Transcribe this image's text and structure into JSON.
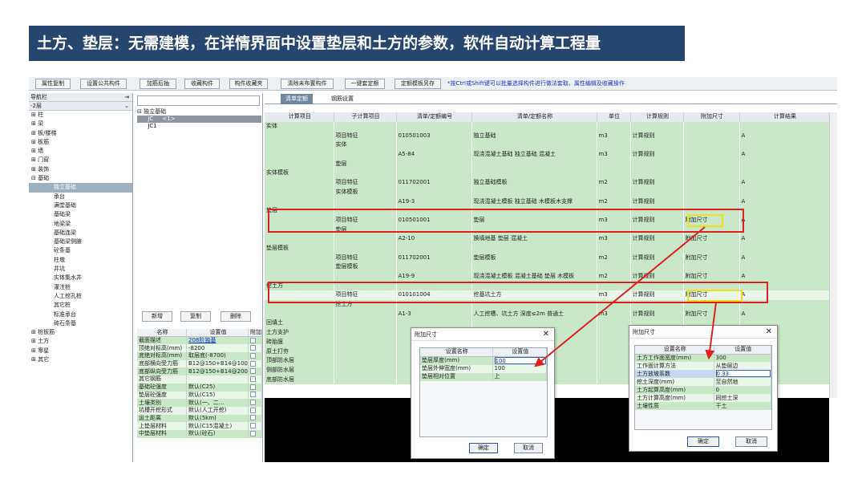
{
  "banner": {
    "title": "土方、垫层：无需建模，在详情界面中设置垫层和土方的参数，软件自动计算工程量"
  },
  "toolbar": {
    "buttons": [
      "属性复制",
      "设置公共构件",
      "加筋后抽",
      "收藏构件",
      "构件收藏夹",
      "清除未布置构件",
      "一键套定额",
      "定额模板另存"
    ],
    "note": "*按Ctrl或Shift键可以批量选择构件进行做法套取、属性编辑及收藏操作"
  },
  "nav": {
    "title": "导航栏",
    "floor": "-2层",
    "items": [
      {
        "label": "⊞ 柱",
        "level": 0
      },
      {
        "label": "⊞ 梁",
        "level": 0
      },
      {
        "label": "⊞ 板/楼梯",
        "level": 0
      },
      {
        "label": "⊞ 板筋",
        "level": 0
      },
      {
        "label": "⊞ 墙",
        "level": 0
      },
      {
        "label": "⊞ 门窗",
        "level": 0
      },
      {
        "label": "⊞ 装饰",
        "level": 0
      },
      {
        "label": "⊟ 基础",
        "level": 0
      },
      {
        "label": "独立基础",
        "level": 1,
        "selected": true
      },
      {
        "label": "承台",
        "level": 1
      },
      {
        "label": "满堂基础",
        "level": 1
      },
      {
        "label": "基础梁",
        "level": 1
      },
      {
        "label": "地梁梁",
        "level": 1
      },
      {
        "label": "基础连梁",
        "level": 1
      },
      {
        "label": "基础梁侧腋",
        "level": 1
      },
      {
        "label": "砼条基",
        "level": 1
      },
      {
        "label": "柱墩",
        "level": 1
      },
      {
        "label": "井坑",
        "level": 1
      },
      {
        "label": "实体集水井",
        "level": 1
      },
      {
        "label": "灌注桩",
        "level": 1
      },
      {
        "label": "人工挖孔桩",
        "level": 1
      },
      {
        "label": "其它桩",
        "level": 1
      },
      {
        "label": "标准承台",
        "level": 1
      },
      {
        "label": "砖石条基",
        "level": 1
      },
      {
        "label": "⊞ 桩板筋",
        "level": 0
      },
      {
        "label": "⊞ 土方",
        "level": 0
      },
      {
        "label": "⊞ 零星",
        "level": 0
      },
      {
        "label": "⊞ 其它",
        "level": 0
      }
    ]
  },
  "components": {
    "tree": [
      {
        "label": "⊟ 独立基础",
        "selected": false
      },
      {
        "label": "      JC     <1>",
        "selected": true
      },
      {
        "label": "      JC1",
        "selected": false
      }
    ],
    "buttons": [
      "新增",
      "复制",
      "删除"
    ]
  },
  "props": {
    "headers": [
      "名称",
      "设置值",
      "附加"
    ],
    "rows": [
      {
        "name": "截面描述",
        "value": "208阶独基",
        "link": true
      },
      {
        "name": "顶绝对标高(mm)",
        "value": "-8200"
      },
      {
        "name": "底绝对标高(mm)",
        "value": "取层底(-8700)"
      },
      {
        "name": "底部横向受力筋",
        "value": "B12@150+B14@100"
      },
      {
        "name": "底部纵向受力筋",
        "value": "B12@150+B14@200"
      },
      {
        "name": "其它钢筋",
        "value": ""
      },
      {
        "name": "基础砼强度",
        "value": "默认(C25)"
      },
      {
        "name": "垫层砼强度",
        "value": "默认(C15)"
      },
      {
        "name": "土壤类别",
        "value": "默认(一、二..."
      },
      {
        "name": "坑槽开挖形式",
        "value": "默认(人工开挖)"
      },
      {
        "name": "运土距离",
        "value": "默认(5km)"
      },
      {
        "name": "上垫层材料",
        "value": "默认(C15混凝土)"
      },
      {
        "name": "中垫层材料",
        "value": "默认(砼石)"
      }
    ]
  },
  "tabs": [
    "清单定额",
    "钢筋设置"
  ],
  "grid": {
    "headers": [
      "计算项目",
      "子计算项目",
      "清单/定额编号",
      "清单/定额名称",
      "单位",
      "计算规则",
      "附加尺寸",
      "计算结果"
    ],
    "rows": [
      {
        "c": [
          "实体",
          "",
          "",
          "",
          "",
          "",
          "",
          ""
        ],
        "t": "g"
      },
      {
        "c": [
          "",
          "项目特征",
          "010501003",
          "独立基础",
          "m3",
          "计算规则",
          "",
          "A"
        ],
        "t": "g"
      },
      {
        "c": [
          "",
          "实体",
          "",
          "",
          "",
          "",
          "",
          ""
        ],
        "t": "g"
      },
      {
        "c": [
          "",
          "",
          "A5-84",
          "现浇混凝土基础 独立基础 混凝土",
          "m3",
          "计算规则",
          "",
          "A"
        ],
        "t": "g"
      },
      {
        "c": [
          "",
          "垫层",
          "",
          "",
          "",
          "",
          "",
          ""
        ],
        "t": "g"
      },
      {
        "c": [
          "实体模板",
          "",
          "",
          "",
          "",
          "",
          "",
          ""
        ],
        "t": "g"
      },
      {
        "c": [
          "",
          "项目特征",
          "011702001",
          "独立基础模板",
          "m2",
          "计算规则",
          "",
          "A"
        ],
        "t": "g"
      },
      {
        "c": [
          "",
          "实体模板",
          "",
          "",
          "",
          "",
          "",
          ""
        ],
        "t": "g"
      },
      {
        "c": [
          "",
          "",
          "A19-3",
          "现浇混凝土模板 独立基础 木模板木支撑",
          "m2",
          "计算规则",
          "",
          "A"
        ],
        "t": "g"
      },
      {
        "c": [
          "垫层",
          "",
          "",
          "",
          "",
          "",
          "",
          ""
        ],
        "t": "g"
      },
      {
        "c": [
          "",
          "项目特征",
          "010501001",
          "垫层",
          "m3",
          "计算规则",
          "附加尺寸",
          "A"
        ],
        "t": "g"
      },
      {
        "c": [
          "",
          "垫层",
          "",
          "",
          "",
          "",
          "",
          ""
        ],
        "t": "g"
      },
      {
        "c": [
          "",
          "",
          "A2-10",
          "换填地基 垫层 混凝土",
          "m3",
          "计算规则",
          "附加尺寸",
          "A"
        ],
        "t": "g"
      },
      {
        "c": [
          "垫层模板",
          "",
          "",
          "",
          "",
          "",
          "",
          ""
        ],
        "t": "g"
      },
      {
        "c": [
          "",
          "项目特征",
          "011702001",
          "垫层模板",
          "m2",
          "计算规则",
          "附加尺寸",
          "A"
        ],
        "t": "g"
      },
      {
        "c": [
          "",
          "垫层模板",
          "",
          "",
          "",
          "",
          "",
          ""
        ],
        "t": "g"
      },
      {
        "c": [
          "",
          "",
          "A19-9",
          "现浇混凝土模板 混凝土基础 垫层 木模板",
          "m2",
          "计算规则",
          "附加尺寸",
          "A"
        ],
        "t": "g"
      },
      {
        "c": [
          "挖土方",
          "",
          "",
          "",
          "",
          "",
          "",
          ""
        ],
        "t": "g"
      },
      {
        "c": [
          "",
          "项目特征",
          "010101004",
          "挖基坑土方",
          "m3",
          "计算规则",
          "附加尺寸",
          "A"
        ],
        "t": "w"
      },
      {
        "c": [
          "",
          "挖土方",
          "",
          "",
          "",
          "",
          "",
          ""
        ],
        "t": "g"
      },
      {
        "c": [
          "",
          "",
          "A1-3",
          "人工挖槽、坑土方 深度≤2m 普通土",
          "m3",
          "计算规则",
          "附加尺寸",
          "A"
        ],
        "t": "g"
      },
      {
        "c": [
          "回填土",
          "",
          "",
          "",
          "",
          "",
          "",
          ""
        ],
        "t": "g"
      },
      {
        "c": [
          "土方支护",
          "",
          "",
          "",
          "",
          "",
          "",
          ""
        ],
        "t": "g"
      },
      {
        "c": [
          "砖胎膜",
          "",
          "",
          "",
          "",
          "",
          "",
          ""
        ],
        "t": "g"
      },
      {
        "c": [
          "原土打夯",
          "",
          "",
          "",
          "",
          "",
          "",
          ""
        ],
        "t": "g"
      },
      {
        "c": [
          "顶部防水层",
          "",
          "",
          "",
          "",
          "",
          "",
          ""
        ],
        "t": "g"
      },
      {
        "c": [
          "侧部防水层",
          "",
          "",
          "",
          "",
          "",
          "",
          ""
        ],
        "t": "g"
      },
      {
        "c": [
          "底部防水层",
          "",
          "",
          "",
          "",
          "",
          "",
          ""
        ],
        "t": "g"
      }
    ]
  },
  "dialog1": {
    "title": "附加尺寸",
    "close": "✕",
    "headers": [
      "设置名称",
      "设置值"
    ],
    "rows": [
      {
        "name": "垫层厚度(mm)",
        "value": "100",
        "editing": true
      },
      {
        "name": "垫层外伸宽度(mm)",
        "value": "100"
      },
      {
        "name": "垫层相对位置",
        "value": "上"
      }
    ],
    "ok": "确定",
    "cancel": "取消"
  },
  "dialog2": {
    "title": "附加尺寸",
    "close": "✕",
    "headers": [
      "设置名称",
      "设置值"
    ],
    "rows": [
      {
        "name": "土方工作面宽度(mm)",
        "value": "300"
      },
      {
        "name": "工作面计算方法",
        "value": "从垫层边"
      },
      {
        "name": "土方放坡系数",
        "value": "0.33",
        "editing": true
      },
      {
        "name": "挖土深度(mm)",
        "value": "至自然地"
      },
      {
        "name": "土方起算高度(mm)",
        "value": "0"
      },
      {
        "name": "土方计算高度(mm)",
        "value": "同挖土深"
      },
      {
        "name": "土壤性质",
        "value": "干土"
      }
    ],
    "ok": "确定",
    "cancel": "取消"
  },
  "colors": {
    "banner": "#26466d",
    "highlight_red": "#e02020",
    "highlight_yellow": "#f0e020",
    "row_green": "#c8e8c8"
  }
}
